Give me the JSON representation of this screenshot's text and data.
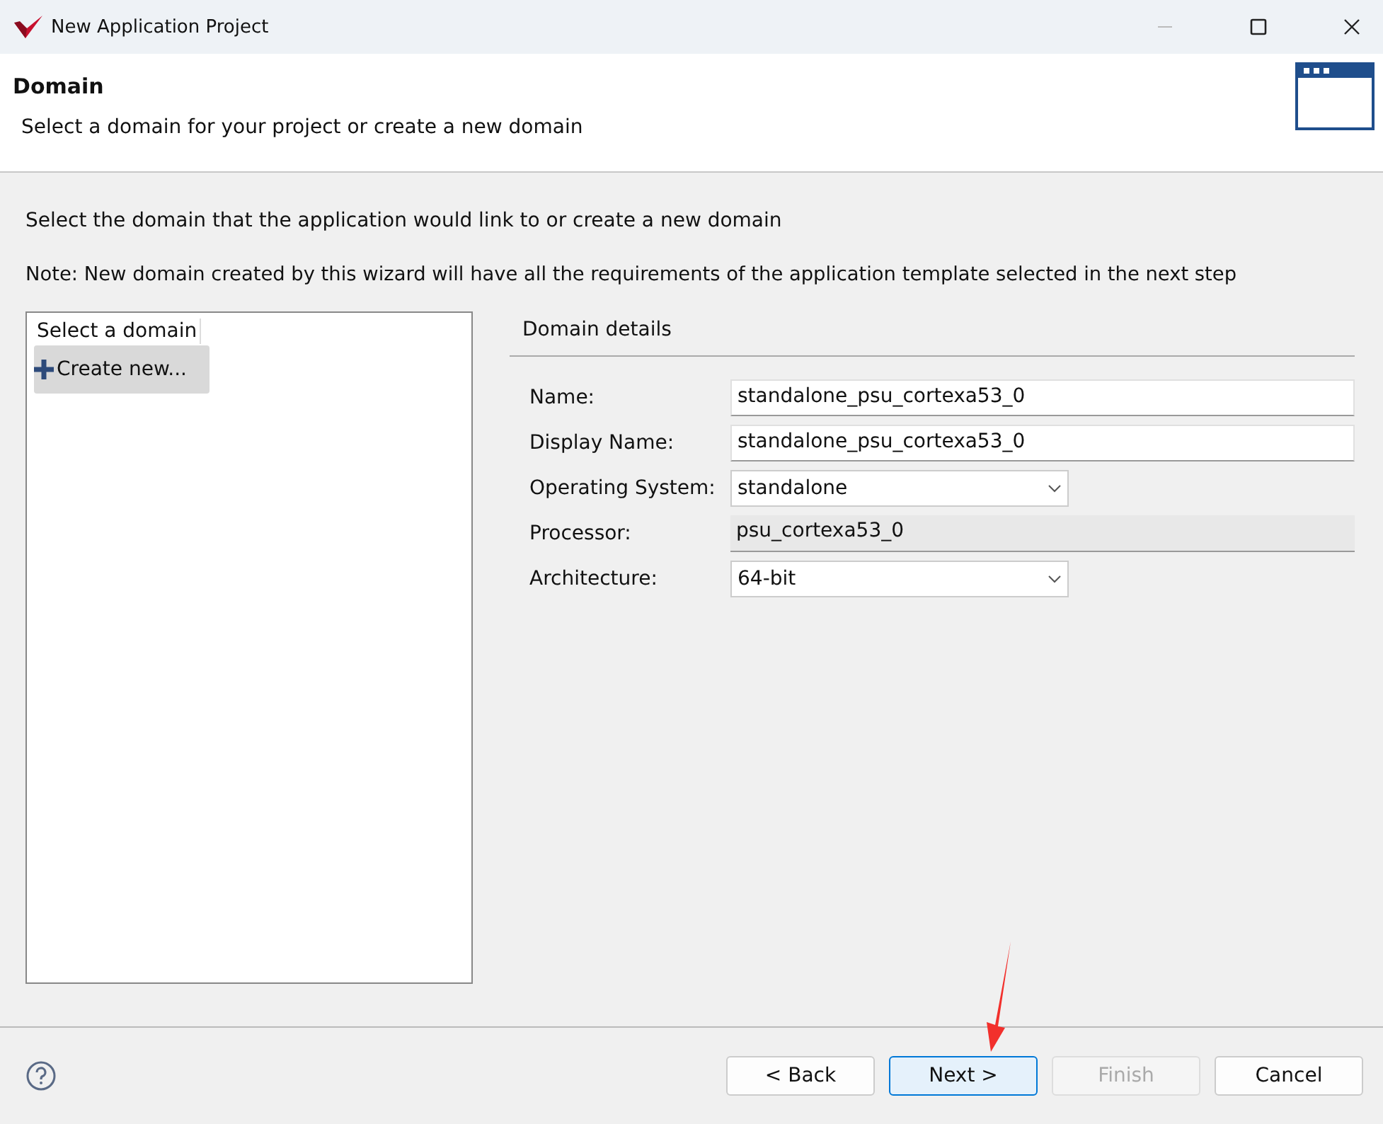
{
  "window": {
    "title": "New Application Project"
  },
  "header": {
    "title": "Domain",
    "subtitle": "Select a domain for your project or create a new domain"
  },
  "intro": "Select the domain that the application would link to or create a new domain",
  "note": "Note: New domain created by this wizard will have all the requirements of the application template selected in the next step",
  "domain_list": {
    "heading": "Select a domain",
    "items": [
      {
        "label": "Create new...",
        "selected": true
      }
    ]
  },
  "details": {
    "title": "Domain details",
    "fields": [
      {
        "label": "Name:",
        "kind": "text",
        "value": "standalone_psu_cortexa53_0"
      },
      {
        "label": "Display Name:",
        "kind": "text",
        "value": "standalone_psu_cortexa53_0"
      },
      {
        "label": "Operating System:",
        "kind": "select",
        "value": "standalone"
      },
      {
        "label": "Processor:",
        "kind": "readonly",
        "value": "psu_cortexa53_0"
      },
      {
        "label": "Architecture:",
        "kind": "select",
        "value": "64-bit"
      }
    ]
  },
  "buttons": [
    {
      "label": "< Back",
      "disabled": false,
      "default": false
    },
    {
      "label": "Next >",
      "disabled": false,
      "default": true
    },
    {
      "label": "Finish",
      "disabled": true,
      "default": false
    },
    {
      "label": "Cancel",
      "disabled": false,
      "default": false
    }
  ]
}
